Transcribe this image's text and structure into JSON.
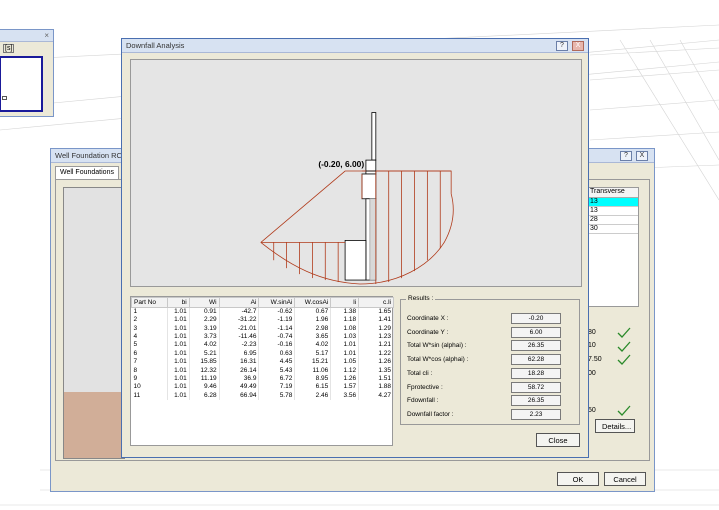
{
  "small_window": {
    "title_button": "[s]"
  },
  "well_window": {
    "title": "Well Foundation RC -",
    "tab": "Well Foundations",
    "help_label": "?",
    "close_label": "X",
    "transverse": {
      "header": "Transverse",
      "values": [
        "13",
        "13",
        "28",
        "30"
      ]
    },
    "right_values": [
      "80",
      "10",
      "7.50",
      "00",
      "50"
    ],
    "details_label": "Details...",
    "ok_label": "OK",
    "cancel_label": "Cancel"
  },
  "dialog": {
    "title": "Downfall Analysis",
    "help_label": "?",
    "close_label": "X",
    "coordinate_label": "(-0.20, 6.00)",
    "table": {
      "headers": [
        "Part No",
        "bi",
        "Wi",
        "Ai",
        "W.sinAi",
        "W.cosAi",
        "li",
        "c.li"
      ],
      "rows": [
        [
          "1",
          "1.01",
          "0.91",
          "-42.7",
          "-0.62",
          "0.67",
          "1.38",
          "1.65"
        ],
        [
          "2",
          "1.01",
          "2.29",
          "-31.22",
          "-1.19",
          "1.96",
          "1.18",
          "1.41"
        ],
        [
          "3",
          "1.01",
          "3.19",
          "-21.01",
          "-1.14",
          "2.98",
          "1.08",
          "1.29"
        ],
        [
          "4",
          "1.01",
          "3.73",
          "-11.46",
          "-0.74",
          "3.65",
          "1.03",
          "1.23"
        ],
        [
          "5",
          "1.01",
          "4.02",
          "-2.23",
          "-0.16",
          "4.02",
          "1.01",
          "1.21"
        ],
        [
          "6",
          "1.01",
          "5.21",
          "6.95",
          "0.63",
          "5.17",
          "1.01",
          "1.22"
        ],
        [
          "7",
          "1.01",
          "15.85",
          "16.31",
          "4.45",
          "15.21",
          "1.05",
          "1.26"
        ],
        [
          "8",
          "1.01",
          "12.32",
          "26.14",
          "5.43",
          "11.06",
          "1.12",
          "1.35"
        ],
        [
          "9",
          "1.01",
          "11.19",
          "36.9",
          "6.72",
          "8.95",
          "1.26",
          "1.51"
        ],
        [
          "10",
          "1.01",
          "9.46",
          "49.49",
          "7.19",
          "6.15",
          "1.57",
          "1.88"
        ],
        [
          "11",
          "1.01",
          "6.28",
          "66.94",
          "5.78",
          "2.46",
          "3.56",
          "4.27"
        ]
      ]
    },
    "results": {
      "title": "Results :",
      "items": [
        {
          "label": "Coordinate X :",
          "value": "-0.20"
        },
        {
          "label": "Coordinate Y :",
          "value": "6.00"
        },
        {
          "label": "Total W*sin (alphai) :",
          "value": "26.35"
        },
        {
          "label": "Total W*cos (alphai) :",
          "value": "62.28"
        },
        {
          "label": "Total cli :",
          "value": "18.28"
        },
        {
          "label": "Fprotective :",
          "value": "58.72"
        },
        {
          "label": "Fdownfall :",
          "value": "26.35"
        },
        {
          "label": "Downfall factor :",
          "value": "2.23"
        }
      ]
    },
    "close_button_label": "Close"
  },
  "colors": {
    "slice_line": "#b03a1a",
    "accent_selected": "#00ffff",
    "check": "#2a8a2a"
  }
}
